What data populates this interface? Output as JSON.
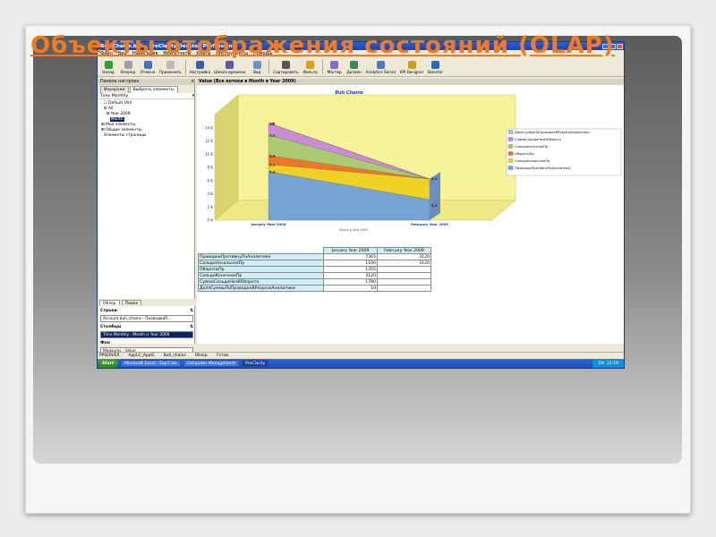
{
  "slide": {
    "title": "Объекты отображения состояний (OLAP)"
  },
  "window": {
    "title": "Buh Chains.bbk - ProClarity Desktop Professional",
    "menu": [
      "Файл",
      "Вид",
      "Навигация",
      "Мои отчеты",
      "Книга",
      "Инструменты",
      "Помощь"
    ],
    "toolbar": [
      "Назад",
      "Вперед",
      "Отмена",
      "Применить",
      "Настройка",
      "Шкала времени",
      "Вид",
      "Сортировать",
      "Фильтр",
      "Мастер",
      "Дизайн",
      "Analytics Server",
      "KPI Designer",
      "Selector"
    ],
    "toolbar_colors": [
      "#2e9e2e",
      "#9aa0a8",
      "#4a6ec8",
      "#b9b9b9",
      "#3a5fb0",
      "#5a5a9a",
      "#6f8fc8",
      "#555555",
      "#d9a020",
      "#8a6bc8",
      "#3a8a5a",
      "#4a7bc8",
      "#c89a2a",
      "#2a6ab8"
    ]
  },
  "left_panel": {
    "header": "Панель настроек",
    "tabs": [
      "Иерархии",
      "Выбрать элементы"
    ],
    "selector": "Time Monthly",
    "tree": [
      "Default (All)",
      "All",
      "Year 2009",
      "Month",
      "Мои элементы",
      "Общие элементы",
      "Элементы страницы"
    ],
    "lower_tabs": [
      "Обзор",
      "Поиск"
    ],
    "rows_label": "Строки",
    "rows_value": "Account buh_chains - ПроводкиП...",
    "cols_label": "Столбцы",
    "cols_value": "Time Monthly - Month is Year 2009",
    "bg_label": "Фон",
    "bg_value": "Measures - Value"
  },
  "right_panel": {
    "header": "Value (Все потоки в Month в Year 2009)"
  },
  "chart_data": {
    "type": "area",
    "title": "Buh Chains",
    "xlabel": "Month в Year 2009",
    "categories": [
      "January Year 2009",
      "February Year 2009"
    ],
    "ylim": [
      0,
      16000
    ],
    "yticks": [
      "0 K",
      "2 K",
      "4 K",
      "6 K",
      "8 K",
      "10 K",
      "12 K",
      "14 K"
    ],
    "series": [
      {
        "name": "ПроводкиПротивнуПоАналитике",
        "values": [
          7365,
          3120
        ],
        "color": "#6fa0d8"
      },
      {
        "name": "СальдоНачальноеПр",
        "values": [
          1100,
          3120
        ],
        "color": "#f0d020"
      },
      {
        "name": "ОборотыПр",
        "values": [
          1355,
          0
        ],
        "color": "#f07020"
      },
      {
        "name": "СальдоКонечноеПр",
        "values": [
          3120,
          0
        ],
        "color": "#a8c870"
      },
      {
        "name": "СуммаСальдоНачИОборота",
        "values": [
          1780,
          0
        ],
        "color": "#c888d8"
      },
      {
        "name": "ДоляСуммыПоПроводкеВРазрезеАналитики",
        "values": [
          10,
          0
        ],
        "color": "#a8c8e8"
      }
    ],
    "data_labels": [
      "10",
      "1,8",
      "1,1",
      "1,4",
      "3,1",
      "7,4",
      "3,1",
      "3,1"
    ],
    "legend": "right"
  },
  "table": {
    "headers": [
      "January Year 2009",
      "February Year 2009"
    ],
    "rows": [
      {
        "label": "ПроводкиПротивнуПоАналитике",
        "v": [
          "7365",
          "3120"
        ]
      },
      {
        "label": "СальдоНачальноеПр",
        "v": [
          "1100",
          "3120"
        ]
      },
      {
        "label": "ОборотыПр",
        "v": [
          "1355",
          ""
        ]
      },
      {
        "label": "СальдоКонечноеПр",
        "v": [
          "3120",
          ""
        ]
      },
      {
        "label": "СуммаСальдоНачИОборота",
        "v": [
          "1780",
          ""
        ]
      },
      {
        "label": "ДоляСуммыПоПроводкеВРазрезеАналитики",
        "v": [
          "10",
          ""
        ]
      }
    ]
  },
  "statusbar": [
    "PPSERVER",
    "AppLC_AppIC",
    "Buh_chains",
    "Обзор",
    "Готов."
  ],
  "taskbar": {
    "start": "Start",
    "tasks": [
      "Microsoft Excel - Exp7.xls",
      "Computer Management",
      "ProClarity"
    ],
    "lang": "EN",
    "time": "15:19"
  }
}
